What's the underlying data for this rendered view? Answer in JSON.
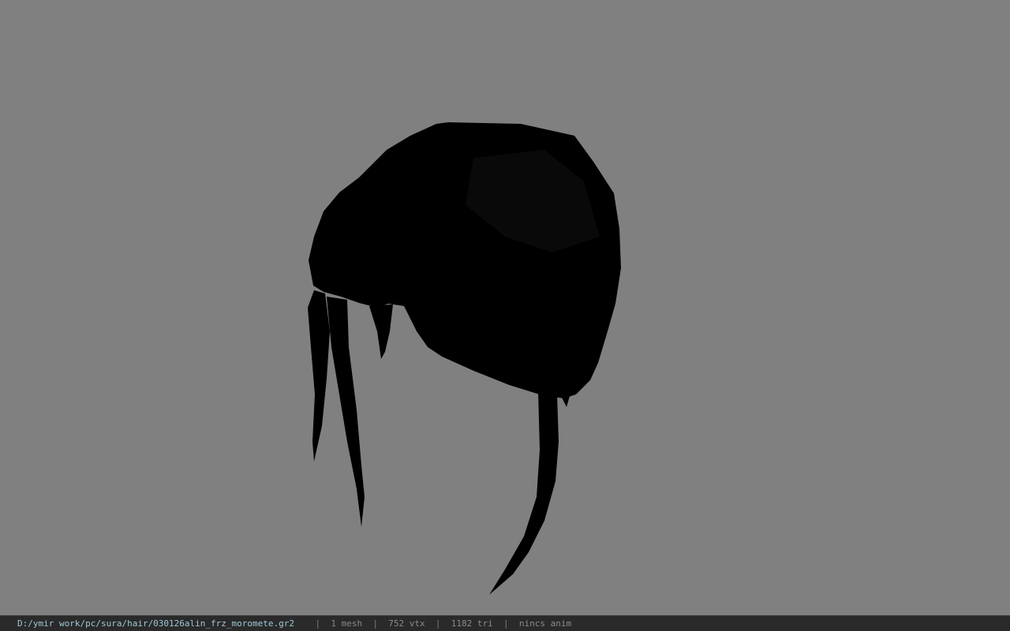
{
  "colors": {
    "viewport_background": "#808080",
    "model_fill": "#000000",
    "status_bar_background": "#2a2a2a",
    "path_text": "#9fc7d8",
    "stats_text": "#8a8a8a"
  },
  "viewport": {
    "model_name": "hair-mesh"
  },
  "status_bar": {
    "file_path": "D:/ymir work/pc/sura/hair/030126alin_frz_moromete.gr2",
    "separator": "|",
    "mesh_count": "1 mesh",
    "vertex_count": "752 vtx",
    "triangle_count": "1182 tri",
    "animation": "nincs anim"
  }
}
